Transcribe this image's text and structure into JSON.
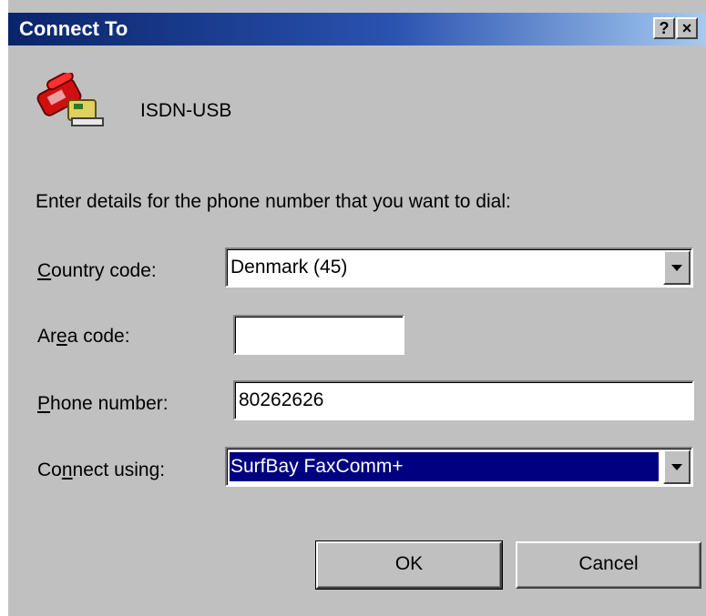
{
  "window": {
    "title": "Connect To",
    "help_label": "?",
    "close_label": "×"
  },
  "connection": {
    "name": "ISDN-USB",
    "icon": "phone-modem-icon"
  },
  "instructions": "Enter details for the phone number that you want to dial:",
  "fields": {
    "country": {
      "label_pre": "",
      "label_key": "C",
      "label_post": "ountry code:",
      "value": "Denmark (45)"
    },
    "area": {
      "label_pre": "Ar",
      "label_key": "e",
      "label_post": "a code:",
      "value": ""
    },
    "phone": {
      "label_pre": "",
      "label_key": "P",
      "label_post": "hone number:",
      "value": "80262626"
    },
    "connect": {
      "label_pre": "Co",
      "label_key": "n",
      "label_post": "nect using:",
      "value": "SurfBay FaxComm+"
    }
  },
  "buttons": {
    "ok": "OK",
    "cancel": "Cancel"
  },
  "colors": {
    "title_start": "#0a246a",
    "title_end": "#a6caf0",
    "face": "#c0c0c0",
    "selection": "#000080"
  }
}
